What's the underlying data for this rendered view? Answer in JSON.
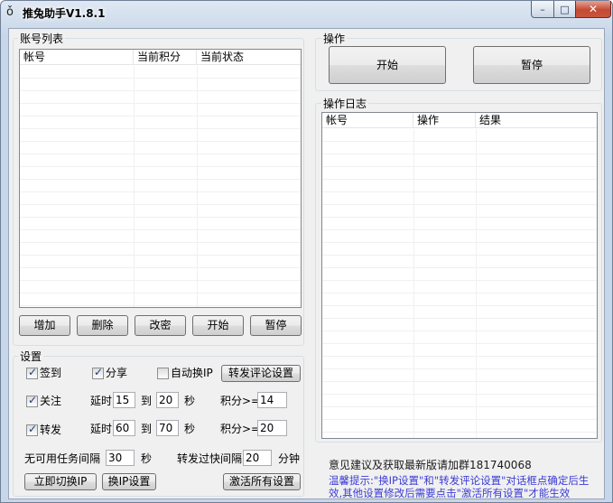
{
  "window": {
    "title": "推兔助手V1.8.1",
    "minimize": "–",
    "maximize": "□",
    "close": "✕"
  },
  "accounts": {
    "group_label": "账号列表",
    "columns": [
      "帐号",
      "当前积分",
      "当前状态"
    ],
    "rows": [],
    "buttons": [
      "增加",
      "删除",
      "改密",
      "开始",
      "暂停"
    ]
  },
  "operation": {
    "group_label": "操作",
    "start": "开始",
    "pause": "暂停"
  },
  "log": {
    "group_label": "操作日志",
    "columns": [
      "帐号",
      "操作",
      "结果"
    ],
    "rows": []
  },
  "settings": {
    "group_label": "设置",
    "signin": {
      "label": "签到",
      "checked": true
    },
    "share": {
      "label": "分享",
      "checked": true
    },
    "auto_ip": {
      "label": "自动换IP",
      "checked": false
    },
    "repost_settings_btn": "转发评论设置",
    "follow": {
      "label": "关注",
      "checked": true,
      "delay_label": "延时",
      "from": "15",
      "to_label": "到",
      "to": "20",
      "sec_label": "秒",
      "points_label": "积分>=",
      "points": "14"
    },
    "repost": {
      "label": "转发",
      "checked": true,
      "delay_label": "延时",
      "from": "60",
      "to_label": "到",
      "to": "70",
      "sec_label": "秒",
      "points_label": "积分>=",
      "points": "20"
    },
    "no_task_label": "无可用任务间隔",
    "no_task_value": "30",
    "no_task_unit": "秒",
    "too_fast_label": "转发过快间隔",
    "too_fast_value": "20",
    "too_fast_unit": "分钟",
    "switch_ip_btn": "立即切换IP",
    "ip_settings_btn": "换IP设置",
    "activate_btn": "激活所有设置"
  },
  "footer": {
    "feedback": "意见建议及获取最新版请加群181740068",
    "tip_line1": "温馨提示:\"换IP设置\"和\"转发评论设置\"对话框点确定后生",
    "tip_line2": "效,其他设置修改后需要点击\"激活所有设置\"才能生效"
  }
}
